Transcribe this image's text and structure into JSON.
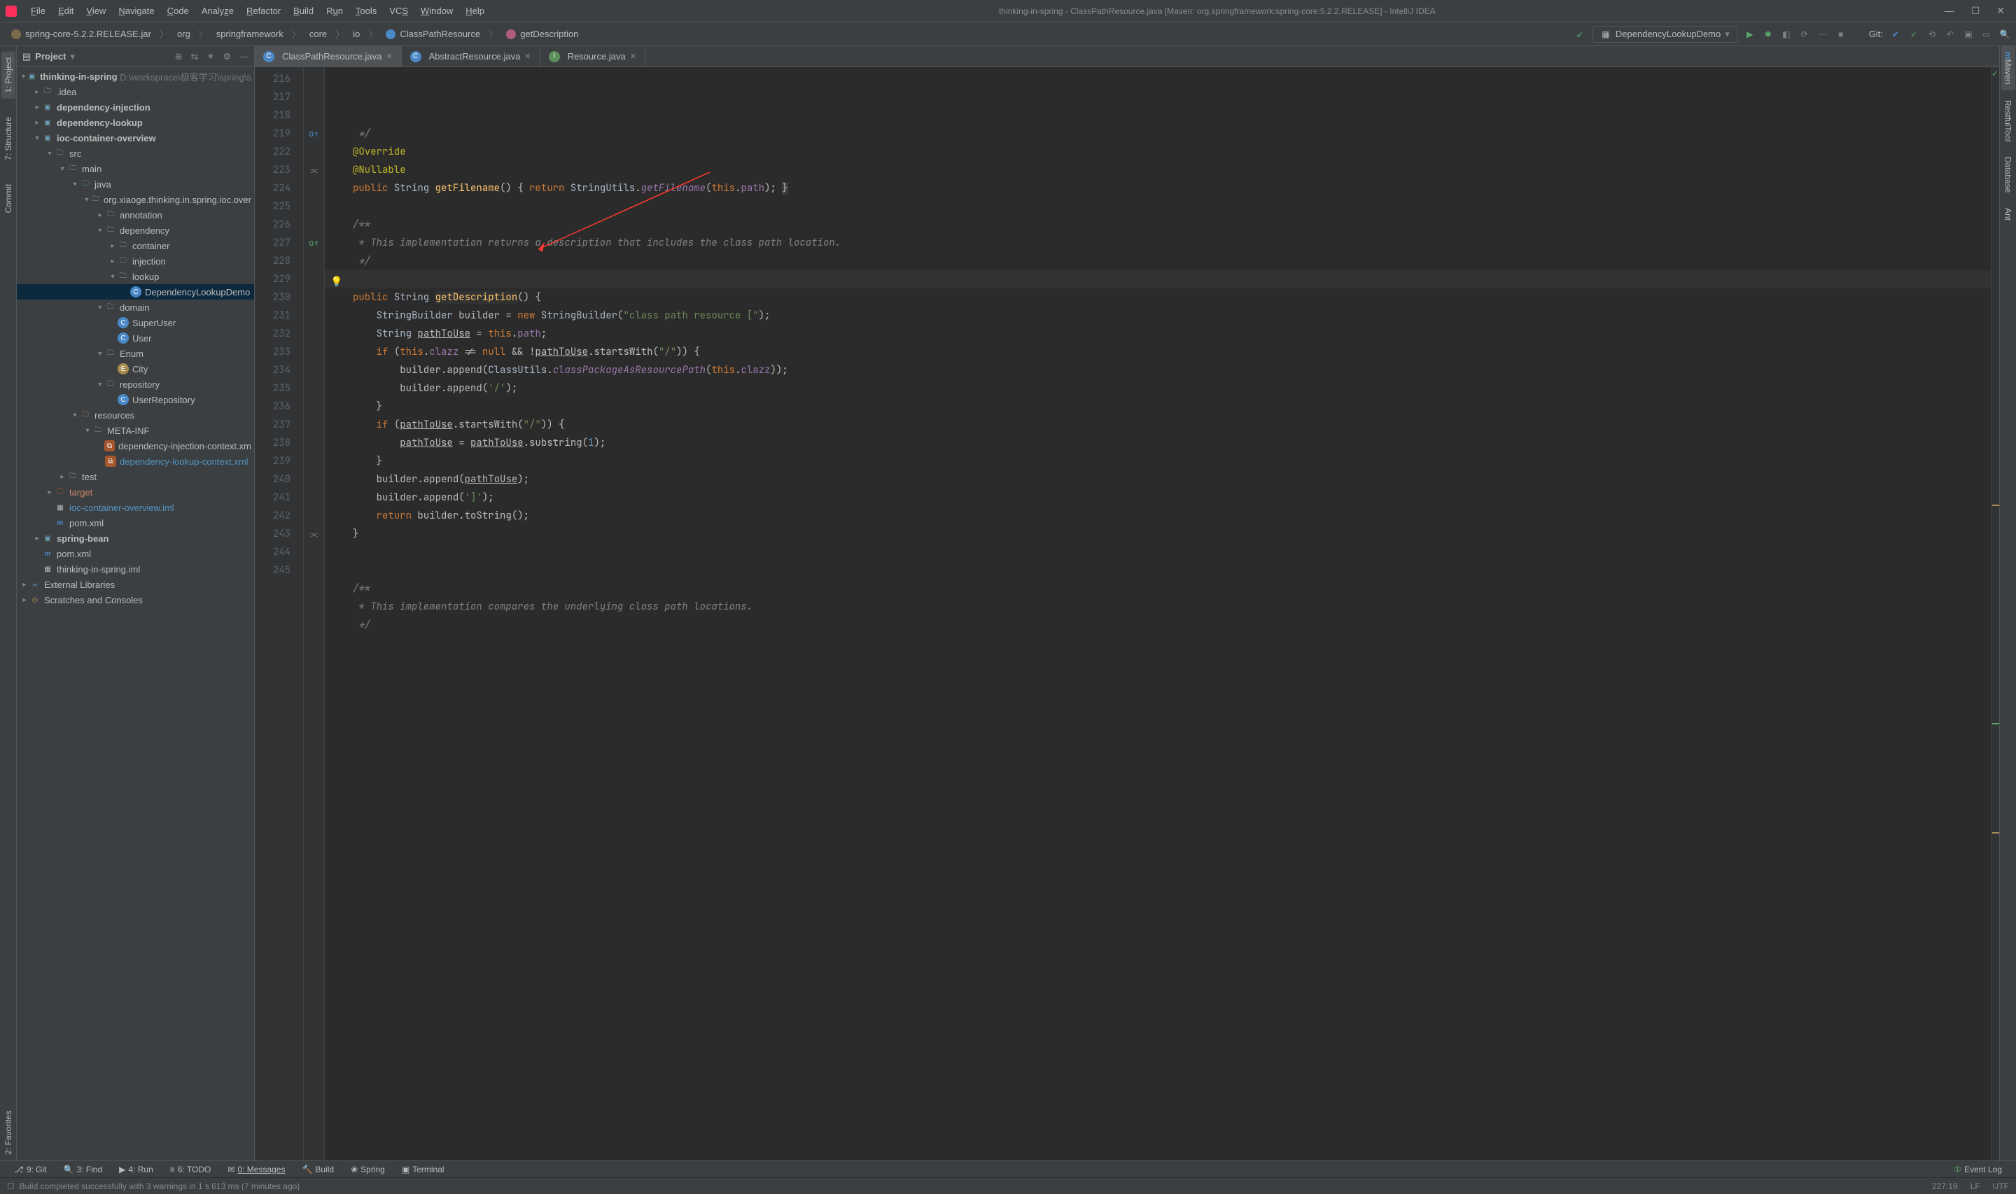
{
  "title": "thinking-in-spring - ClassPathResource.java [Maven: org.springframework:spring-core:5.2.2.RELEASE] - IntelliJ IDEA",
  "menu": [
    "File",
    "Edit",
    "View",
    "Navigate",
    "Code",
    "Analyze",
    "Refactor",
    "Build",
    "Run",
    "Tools",
    "VCS",
    "Window",
    "Help"
  ],
  "breadcrumbs": {
    "jar": "spring-core-5.2.2.RELEASE.jar",
    "parts": [
      "org",
      "springframework",
      "core",
      "io"
    ],
    "class": "ClassPathResource",
    "method": "getDescription"
  },
  "run_config": "DependencyLookupDemo",
  "git_label": "Git:",
  "panel": {
    "title": "Project"
  },
  "tree": {
    "root": {
      "name": "thinking-in-spring",
      "path": "D:\\worksprace\\极客学习\\spring\\s"
    },
    "children": [
      {
        "name": ".idea"
      },
      {
        "name": "dependency-injection"
      },
      {
        "name": "dependency-lookup"
      },
      {
        "name": "ioc-container-overview"
      },
      {
        "name": "src"
      },
      {
        "name": "main"
      },
      {
        "name": "java"
      },
      {
        "name": "org.xiaoge.thinking.in.spring.ioc.over"
      },
      {
        "name": "annotation"
      },
      {
        "name": "dependency"
      },
      {
        "name": "container"
      },
      {
        "name": "injection"
      },
      {
        "name": "lookup"
      },
      {
        "name": "DependencyLookupDemo",
        "sel": true
      },
      {
        "name": "domain"
      },
      {
        "name": "SuperUser"
      },
      {
        "name": "User"
      },
      {
        "name": "Enum"
      },
      {
        "name": "City"
      },
      {
        "name": "repository"
      },
      {
        "name": "UserRepository"
      },
      {
        "name": "resources"
      },
      {
        "name": "META-INF"
      },
      {
        "name": "dependency-injection-context.xm"
      },
      {
        "name": "dependency-lookup-context.xml"
      },
      {
        "name": "test"
      },
      {
        "name": "target"
      },
      {
        "name": "ioc-container-overview.iml"
      },
      {
        "name": "pom.xml"
      },
      {
        "name": "spring-bean"
      },
      {
        "name": "pom.xml"
      },
      {
        "name": "thinking-in-spring.iml"
      },
      {
        "name": "External Libraries"
      },
      {
        "name": "Scratches and Consoles"
      }
    ]
  },
  "tabs": [
    {
      "label": "ClassPathResource.java",
      "active": true,
      "ico": "c"
    },
    {
      "label": "AbstractResource.java",
      "active": false,
      "ico": "c"
    },
    {
      "label": "Resource.java",
      "active": false,
      "ico": "i"
    }
  ],
  "lines": [
    216,
    217,
    218,
    219,
    222,
    223,
    224,
    225,
    226,
    227,
    228,
    229,
    230,
    231,
    232,
    233,
    234,
    235,
    236,
    237,
    238,
    239,
    240,
    241,
    242,
    243,
    244,
    245
  ],
  "code": {
    "l216": " */",
    "override": "@Override",
    "nullable": "@Nullable",
    "pub": "public",
    "str": "String",
    "ret": "return",
    "ifk": "if",
    "newk": "new",
    "nullk": "null",
    "thisk": "this",
    "getFilename": "getFilename",
    "stringUtils": "StringUtils",
    "path": "path",
    "cmt0": "/**",
    "cmt1": " * This implementation returns a description that includes the class path location.",
    "cmt2": " */",
    "getDescription": "getDescription",
    "StringBuilder": "StringBuilder",
    "builder": "builder",
    "slit1": "\"class path resource [\"",
    "pathToUse": "pathToUse",
    "clazz": "clazz",
    "startsWith": "startsWith",
    "slash": "\"/\"",
    "append": "append",
    "ClassUtils": "ClassUtils",
    "cpArp": "classPackageAsResourcePath",
    "slashc": "'/'",
    "substring": "substring",
    "one": "1",
    "close": "']'",
    "toString": "toString",
    "cmt3": "/**",
    "cmt4": " * This implementation compares the underlying class path locations.",
    "cmt5": " */"
  },
  "left_tabs": [
    "1: Project",
    "7: Structure",
    "Commit",
    "2: Favorites"
  ],
  "right_tabs": [
    "Maven",
    "RestfulTool",
    "Database",
    "Ant"
  ],
  "bottom_tabs": [
    "9: Git",
    "3: Find",
    "4: Run",
    "6: TODO",
    "0: Messages",
    "Build",
    "Spring",
    "Terminal"
  ],
  "event_log": "Event Log",
  "status": {
    "msg": "Build completed successfully with 3 warnings in 1 s 613 ms (7 minutes ago)",
    "pos": "227:19",
    "lf": "LF",
    "enc": "UTF"
  }
}
